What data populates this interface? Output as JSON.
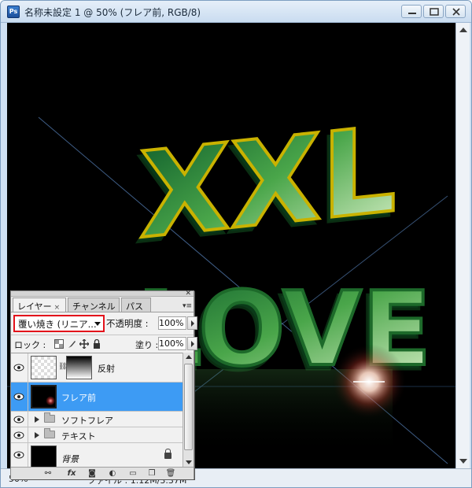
{
  "window": {
    "app_icon_text": "Ps",
    "title": "名称未設定 1 @ 50% (フレア前, RGB/8)"
  },
  "status": {
    "zoom": "50%",
    "file_info": "ファイル : 1.12M/3.37M"
  },
  "artwork": {
    "line1": "XXL",
    "line2": "LOVE",
    "background_color": "#000000",
    "text_color_light": "#d9f0c8",
    "text_color_dark": "#0c5a2a",
    "edge_color": "#c9b200",
    "flare_color": "#ffffff"
  },
  "layers_panel": {
    "tabs": [
      {
        "label": "レイヤー",
        "close": "×",
        "active": true
      },
      {
        "label": "チャンネル",
        "active": false
      },
      {
        "label": "パス",
        "active": false
      }
    ],
    "blend_mode": "覆い焼き (リニア...",
    "opacity_label": "不透明度 :",
    "opacity_value": "100%",
    "lock_label": "ロック :",
    "fill_label": "塗り :",
    "fill_value": "100%",
    "layers": [
      {
        "name": "反射",
        "type": "masked",
        "selected": false
      },
      {
        "name": "フレア前",
        "type": "layer",
        "selected": true
      },
      {
        "name": "ソフトフレア",
        "type": "group",
        "selected": false
      },
      {
        "name": "テキスト",
        "type": "group",
        "selected": false
      },
      {
        "name": "背景",
        "type": "background",
        "selected": false,
        "locked": true
      }
    ],
    "bottom_icons": [
      "link-icon",
      "fx-icon",
      "mask-icon",
      "adjustment-icon",
      "group-folder-icon",
      "new-layer-icon",
      "trash-icon"
    ],
    "selection_color": "#3d9bf4",
    "highlight_box_color": "#e3121b"
  }
}
